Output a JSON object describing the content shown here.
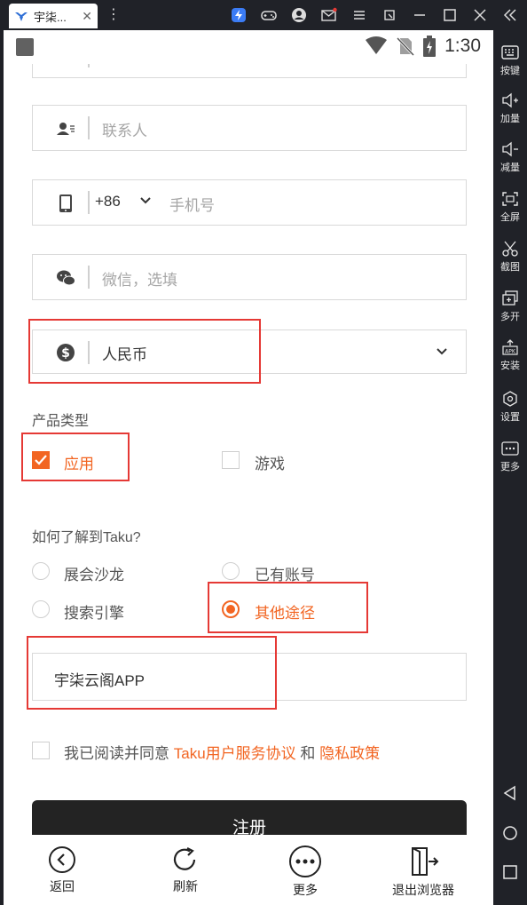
{
  "emulator": {
    "tab_title": "宇柒...",
    "tab_close": "✕",
    "colors": {
      "bar": "#202228",
      "accent": "#f26522",
      "mark": "#e53935"
    }
  },
  "sidebar": {
    "items": [
      {
        "label": "按键",
        "icon": "keyboard-icon"
      },
      {
        "label": "加量",
        "icon": "volume-up-icon"
      },
      {
        "label": "减量",
        "icon": "volume-down-icon"
      },
      {
        "label": "全屏",
        "icon": "fullscreen-icon"
      },
      {
        "label": "截图",
        "icon": "scissors-icon"
      },
      {
        "label": "多开",
        "icon": "multi-open-icon"
      },
      {
        "label": "安装",
        "icon": "apk-install-icon"
      },
      {
        "label": "设置",
        "icon": "settings-icon"
      },
      {
        "label": "更多",
        "icon": "more-icon"
      }
    ]
  },
  "status": {
    "time": "1:30"
  },
  "form": {
    "contact": {
      "placeholder": "联系人"
    },
    "phone": {
      "code": "+86",
      "placeholder": "手机号"
    },
    "wechat": {
      "placeholder": "微信，选填"
    },
    "currency": {
      "value": "人民币"
    },
    "product_type": {
      "label": "产品类型",
      "options": [
        {
          "label": "应用",
          "checked": true
        },
        {
          "label": "游戏",
          "checked": false
        }
      ]
    },
    "source": {
      "label": "如何了解到Taku?",
      "options": [
        {
          "label": "展会沙龙",
          "checked": false
        },
        {
          "label": "已有账号",
          "checked": false
        },
        {
          "label": "搜索引擎",
          "checked": false
        },
        {
          "label": "其他途径",
          "checked": true
        }
      ],
      "other_value": "宇柒云阁APP"
    },
    "agreement": {
      "prefix": "我已阅读并同意 ",
      "terms": "Taku用户服务协议",
      "and": " 和 ",
      "privacy": "隐私政策"
    },
    "register_label": "注册"
  },
  "bottom_bar": {
    "back": "返回",
    "refresh": "刷新",
    "more": "更多",
    "exit": "退出浏览器"
  }
}
